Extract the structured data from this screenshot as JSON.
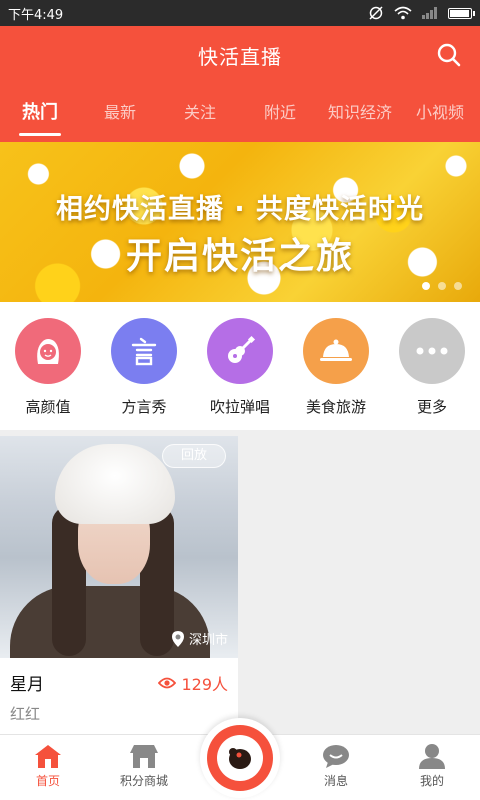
{
  "status_bar": {
    "time": "下午4:49"
  },
  "header": {
    "title": "快活直播",
    "search_icon": "search-icon"
  },
  "tabs": [
    {
      "label": "热门",
      "active": true
    },
    {
      "label": "最新"
    },
    {
      "label": "关注"
    },
    {
      "label": "附近"
    },
    {
      "label": "知识经济"
    },
    {
      "label": "小视频"
    }
  ],
  "banner": {
    "line1": "相约快活直播 · 共度快活时光",
    "line2": "开启快活之旅"
  },
  "categories": [
    {
      "label": "高颜值",
      "icon": "face-icon",
      "color": "#f06a7a"
    },
    {
      "label": "方言秀",
      "icon": "speech-icon",
      "color": "#7b7ef0"
    },
    {
      "label": "吹拉弹唱",
      "icon": "guitar-icon",
      "color": "#b56ee6"
    },
    {
      "label": "美食旅游",
      "icon": "dish-icon",
      "color": "#f5a04a"
    },
    {
      "label": "更多",
      "icon": "more-icon",
      "color": "#c9c9c9"
    }
  ],
  "live_card": {
    "badge": "回放",
    "location": "深圳市",
    "title": "星月",
    "viewers": "129人",
    "host": "红红"
  },
  "tabbar": [
    {
      "label": "首页",
      "icon": "home-icon",
      "active": true
    },
    {
      "label": "积分商城",
      "icon": "store-icon"
    },
    {
      "label": "",
      "icon": "live-icon"
    },
    {
      "label": "消息",
      "icon": "message-icon"
    },
    {
      "label": "我的",
      "icon": "profile-icon"
    }
  ],
  "colors": {
    "accent": "#f5513c"
  }
}
